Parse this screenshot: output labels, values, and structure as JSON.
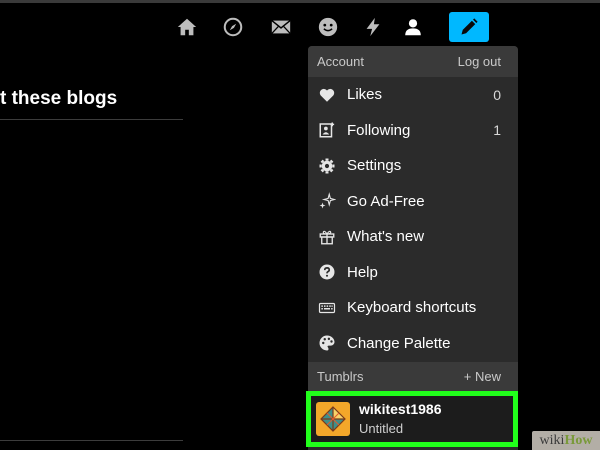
{
  "nav": {
    "icons": [
      "home-icon",
      "explore-icon",
      "inbox-icon",
      "chat-icon",
      "activity-icon",
      "account-icon"
    ],
    "compose_icon": "pencil-icon",
    "accent_color": "#00b8ff"
  },
  "page": {
    "heading": "t these blogs"
  },
  "menu": {
    "account_label": "Account",
    "logout_label": "Log out",
    "items": [
      {
        "label": "Likes",
        "count": "0",
        "icon": "heart-icon"
      },
      {
        "label": "Following",
        "count": "1",
        "icon": "following-icon"
      },
      {
        "label": "Settings",
        "count": "",
        "icon": "gear-icon"
      },
      {
        "label": "Go Ad-Free",
        "count": "",
        "icon": "sparkle-icon"
      },
      {
        "label": "What's new",
        "count": "",
        "icon": "gift-icon"
      },
      {
        "label": "Help",
        "count": "",
        "icon": "help-icon"
      },
      {
        "label": "Keyboard shortcuts",
        "count": "",
        "icon": "keyboard-icon"
      },
      {
        "label": "Change Palette",
        "count": "",
        "icon": "palette-icon"
      }
    ],
    "tumblrs_label": "Tumblrs",
    "new_label": "+ New",
    "blog": {
      "name": "wikitest1986",
      "title": "Untitled",
      "highlight_color": "#21ff1b"
    }
  },
  "watermark": {
    "part1": "wiki",
    "part2": "How"
  }
}
